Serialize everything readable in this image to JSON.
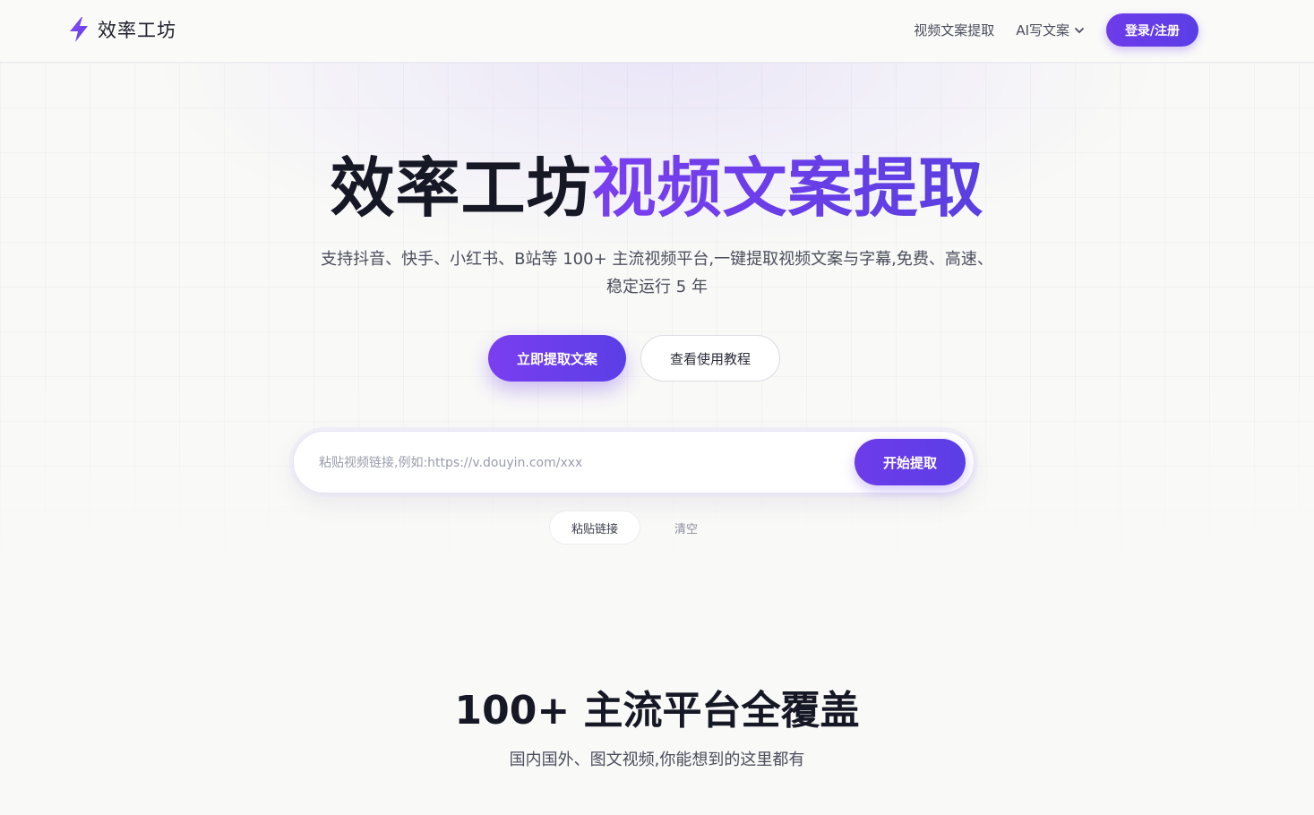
{
  "header": {
    "brand": "效率工坊",
    "nav": [
      {
        "label": "视频文案提取"
      },
      {
        "label": "AI写文案"
      }
    ],
    "login_label": "登录/注册"
  },
  "hero": {
    "title_part1": "效率工坊",
    "title_part2": "视频文案提取",
    "subtitle": "支持抖音、快手、小红书、B站等 100+ 主流视频平台,一键提取视频文案与字幕,免费、高速、稳定运行 5 年",
    "cta_primary": "立即提取文案",
    "cta_secondary": "查看使用教程"
  },
  "search": {
    "value": "",
    "placeholder": "粘贴视频链接,例如:https://v.douyin.com/xxx",
    "submit_label": "开始提取",
    "paste_label": "粘贴链接",
    "clear_label": "清空"
  },
  "platforms": {
    "title": "100+ 主流平台全覆盖",
    "subtitle": "国内国外、图文视频,你能想到的这里都有"
  },
  "colors": {
    "brand": "#6d3bea",
    "accent_end": "#5b3ee6",
    "text_dark": "#171826",
    "text_muted": "#4b4d5c"
  },
  "icons": {
    "logo": "lightning-bolt-icon",
    "dropdown": "chevron-down-icon"
  }
}
